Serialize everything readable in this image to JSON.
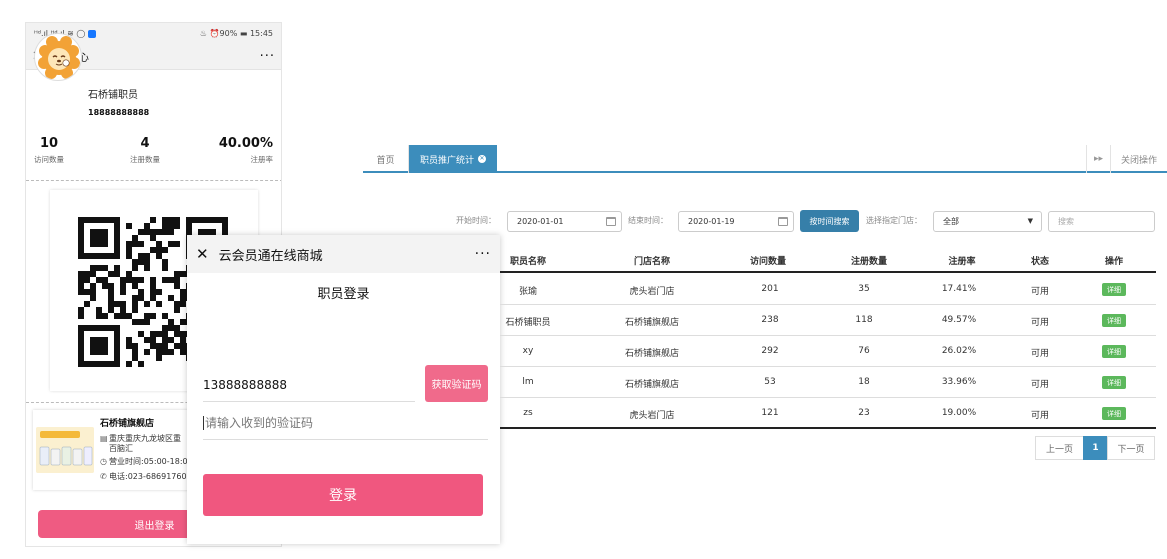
{
  "staff_center": {
    "status_left": "ᴴᵈ.ıl ᴴᵈ.ıl ≋ ◯",
    "status_right": "♨ ⏰90% ▬ 15:45",
    "nav_title": "职员中心",
    "more": "···",
    "name": "石桥铺职员",
    "phone": "18888888888",
    "stats": [
      {
        "value": "10",
        "label": "访问数量"
      },
      {
        "value": "4",
        "label": "注册数量"
      },
      {
        "value": "40.00%",
        "label": "注册率"
      }
    ],
    "store": {
      "name": "石桥铺旗舰店",
      "address": "重庆重庆九龙坡区重",
      "address_line2": "百脑汇",
      "hours": "营业时间:05:00-18:0",
      "phone": "电话:023-68691760"
    },
    "logout_label": "退出登录"
  },
  "login": {
    "nav_title": "云会员通在线商城",
    "more": "···",
    "title": "职员登录",
    "phone_value": "13888888888",
    "code_button": "获取验证码",
    "code_placeholder": "请输入收到的验证码",
    "login_button": "登录"
  },
  "admin": {
    "tabs": {
      "home": "首页",
      "active": "职员推广统计",
      "next": "▸▸",
      "close_ops": "关闭操作"
    },
    "filters": {
      "start_label": "开始时间：",
      "start_value": "2020-01-01",
      "end_label": "结束时间：",
      "end_value": "2020-01-19",
      "search_button": "按时间搜索",
      "store_label": "选择指定门店：",
      "store_value": "全部",
      "search_placeholder": "搜索"
    },
    "columns": [
      "职员名称",
      "门店名称",
      "访问数量",
      "注册数量",
      "注册率",
      "状态",
      "操作"
    ],
    "rows": [
      [
        "张瑜",
        "虎头岩门店",
        "201",
        "35",
        "17.41%",
        "可用",
        "详细"
      ],
      [
        "石桥铺职员",
        "石桥铺旗舰店",
        "238",
        "118",
        "49.57%",
        "可用",
        "详细"
      ],
      [
        "xy",
        "石桥铺旗舰店",
        "292",
        "76",
        "26.02%",
        "可用",
        "详细"
      ],
      [
        "lm",
        "石桥铺旗舰店",
        "53",
        "18",
        "33.96%",
        "可用",
        "详细"
      ],
      [
        "zs",
        "虎头岩门店",
        "121",
        "23",
        "19.00%",
        "可用",
        "详细"
      ]
    ],
    "pagination": {
      "prev": "上一页",
      "current": "1",
      "next": "下一页"
    }
  },
  "colors": {
    "pink": "#ef5b82",
    "primary_blue": "#3c8dbc",
    "success_green": "#5cb85c"
  }
}
